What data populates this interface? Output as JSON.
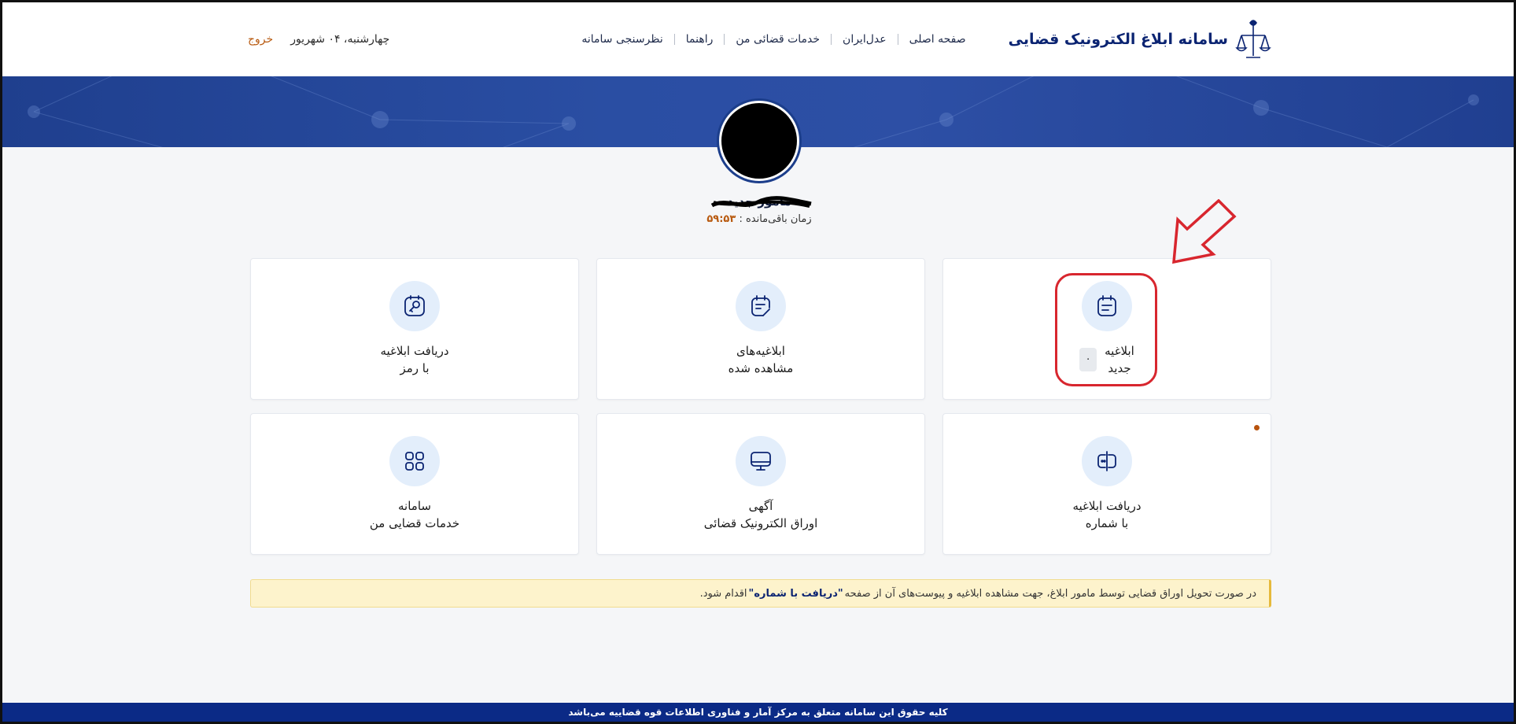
{
  "header": {
    "title": "سامانه ابلاغ الکترونیک قضایی",
    "nav": [
      {
        "label": "صفحه اصلی"
      },
      {
        "label": "عدل‌ایران"
      },
      {
        "label": "خدمات قضائی من"
      },
      {
        "label": "راهنما"
      },
      {
        "label": "نظرسنجی سامانه"
      }
    ],
    "date": "چهارشنبه، ۰۴ شهریور",
    "logout": "خروج"
  },
  "profile": {
    "name": "مامور جدید",
    "timer_label": "زمان باقی‌مانده :",
    "timer_value": "۵۹:۵۳"
  },
  "cards": {
    "new_notice": {
      "line1": "ابلاغیه",
      "line2": "جدید",
      "count": "۰"
    },
    "viewed_notices": {
      "line1": "ابلاغیه‌های",
      "line2": "مشاهده شده"
    },
    "receive_by_password": {
      "line1": "دریافت ابلاغیه",
      "line2": "با رمز"
    },
    "receive_by_number": {
      "line1": "دریافت ابلاغیه",
      "line2": "با شماره"
    },
    "electronic_docs": {
      "line1": "آگهی",
      "line2": "اوراق الکترونیک قضائی"
    },
    "my_services": {
      "line1": "سامانه",
      "line2": "خدمات قضایی من"
    }
  },
  "notice": {
    "before": "در صورت تحویل اوراق قضایی توسط مامور ابلاغ، جهت مشاهده ابلاغیه و پیوست‌های آن از صفحه",
    "link": "\"دریافت با شماره\"",
    "after": "اقدام شود."
  },
  "footer": {
    "text": "کلیه حقوق این سامانه متعلق به مرکز آمار و فناوری اطلاعات قوه قضاییه می‌باشد"
  },
  "colors": {
    "brand": "#0b2472",
    "accent": "#b85a10",
    "highlight": "#d8262e",
    "banner": "#2a4ea3",
    "icon_bg": "#e3eefb"
  }
}
